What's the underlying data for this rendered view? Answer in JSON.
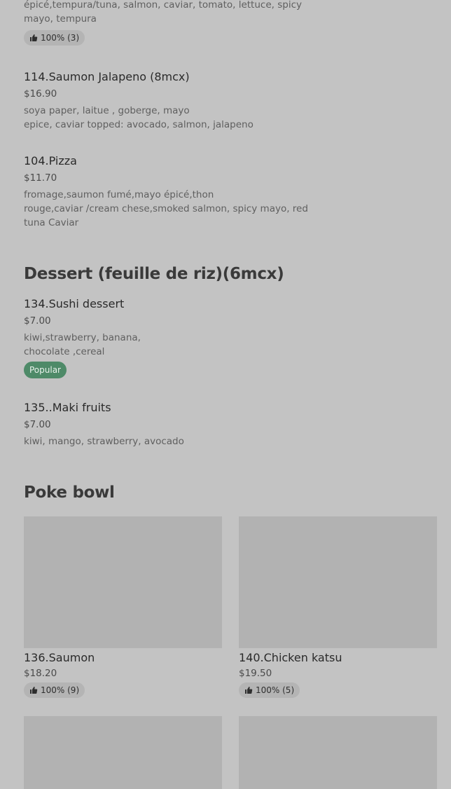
{
  "items_top": [
    {
      "desc_lines": [
        "épicé,tempura/tuna, salmon, caviar, tomato, lettuce, spicy",
        "mayo, tempura"
      ],
      "rating": "100% (3)"
    }
  ],
  "items": [
    {
      "title": "114.Saumon Jalapeno (8mcx)",
      "price": "$16.90",
      "desc_lines": [
        "soya paper, laitue , goberge, mayo",
        "epice, caviar topped: avocado, salmon, jalapeno"
      ]
    },
    {
      "title": "104.Pizza",
      "price": "$11.70",
      "desc_lines": [
        "fromage,saumon fumé,mayo épicé,thon",
        "rouge,caviar /cream chese,smoked salmon, spicy mayo, red",
        "tuna Caviar"
      ]
    }
  ],
  "dessert": {
    "title": "Dessert (feuille de riz)(6mcx)",
    "items": [
      {
        "title": "134.Sushi dessert",
        "price": "$7.00",
        "desc_lines": [
          "kiwi,strawberry, banana,",
          "chocolate ,cereal"
        ],
        "badge": "Popular"
      },
      {
        "title": "135..Maki fruits",
        "price": "$7.00",
        "desc_lines": [
          "kiwi, mango, strawberry, avocado"
        ]
      }
    ]
  },
  "poke": {
    "title": "Poke bowl",
    "cards": [
      {
        "title": "136.Saumon",
        "price": "$18.20",
        "rating": "100% (9)"
      },
      {
        "title": "140.Chicken katsu",
        "price": "$19.50",
        "rating": "100% (5)"
      }
    ]
  },
  "icons": {
    "rating": "thumbs-up-icon"
  },
  "colors": {
    "background": "#c3c3c3",
    "popular_badge": "#4e8a68",
    "image_placeholder": "#b2b2b2"
  }
}
